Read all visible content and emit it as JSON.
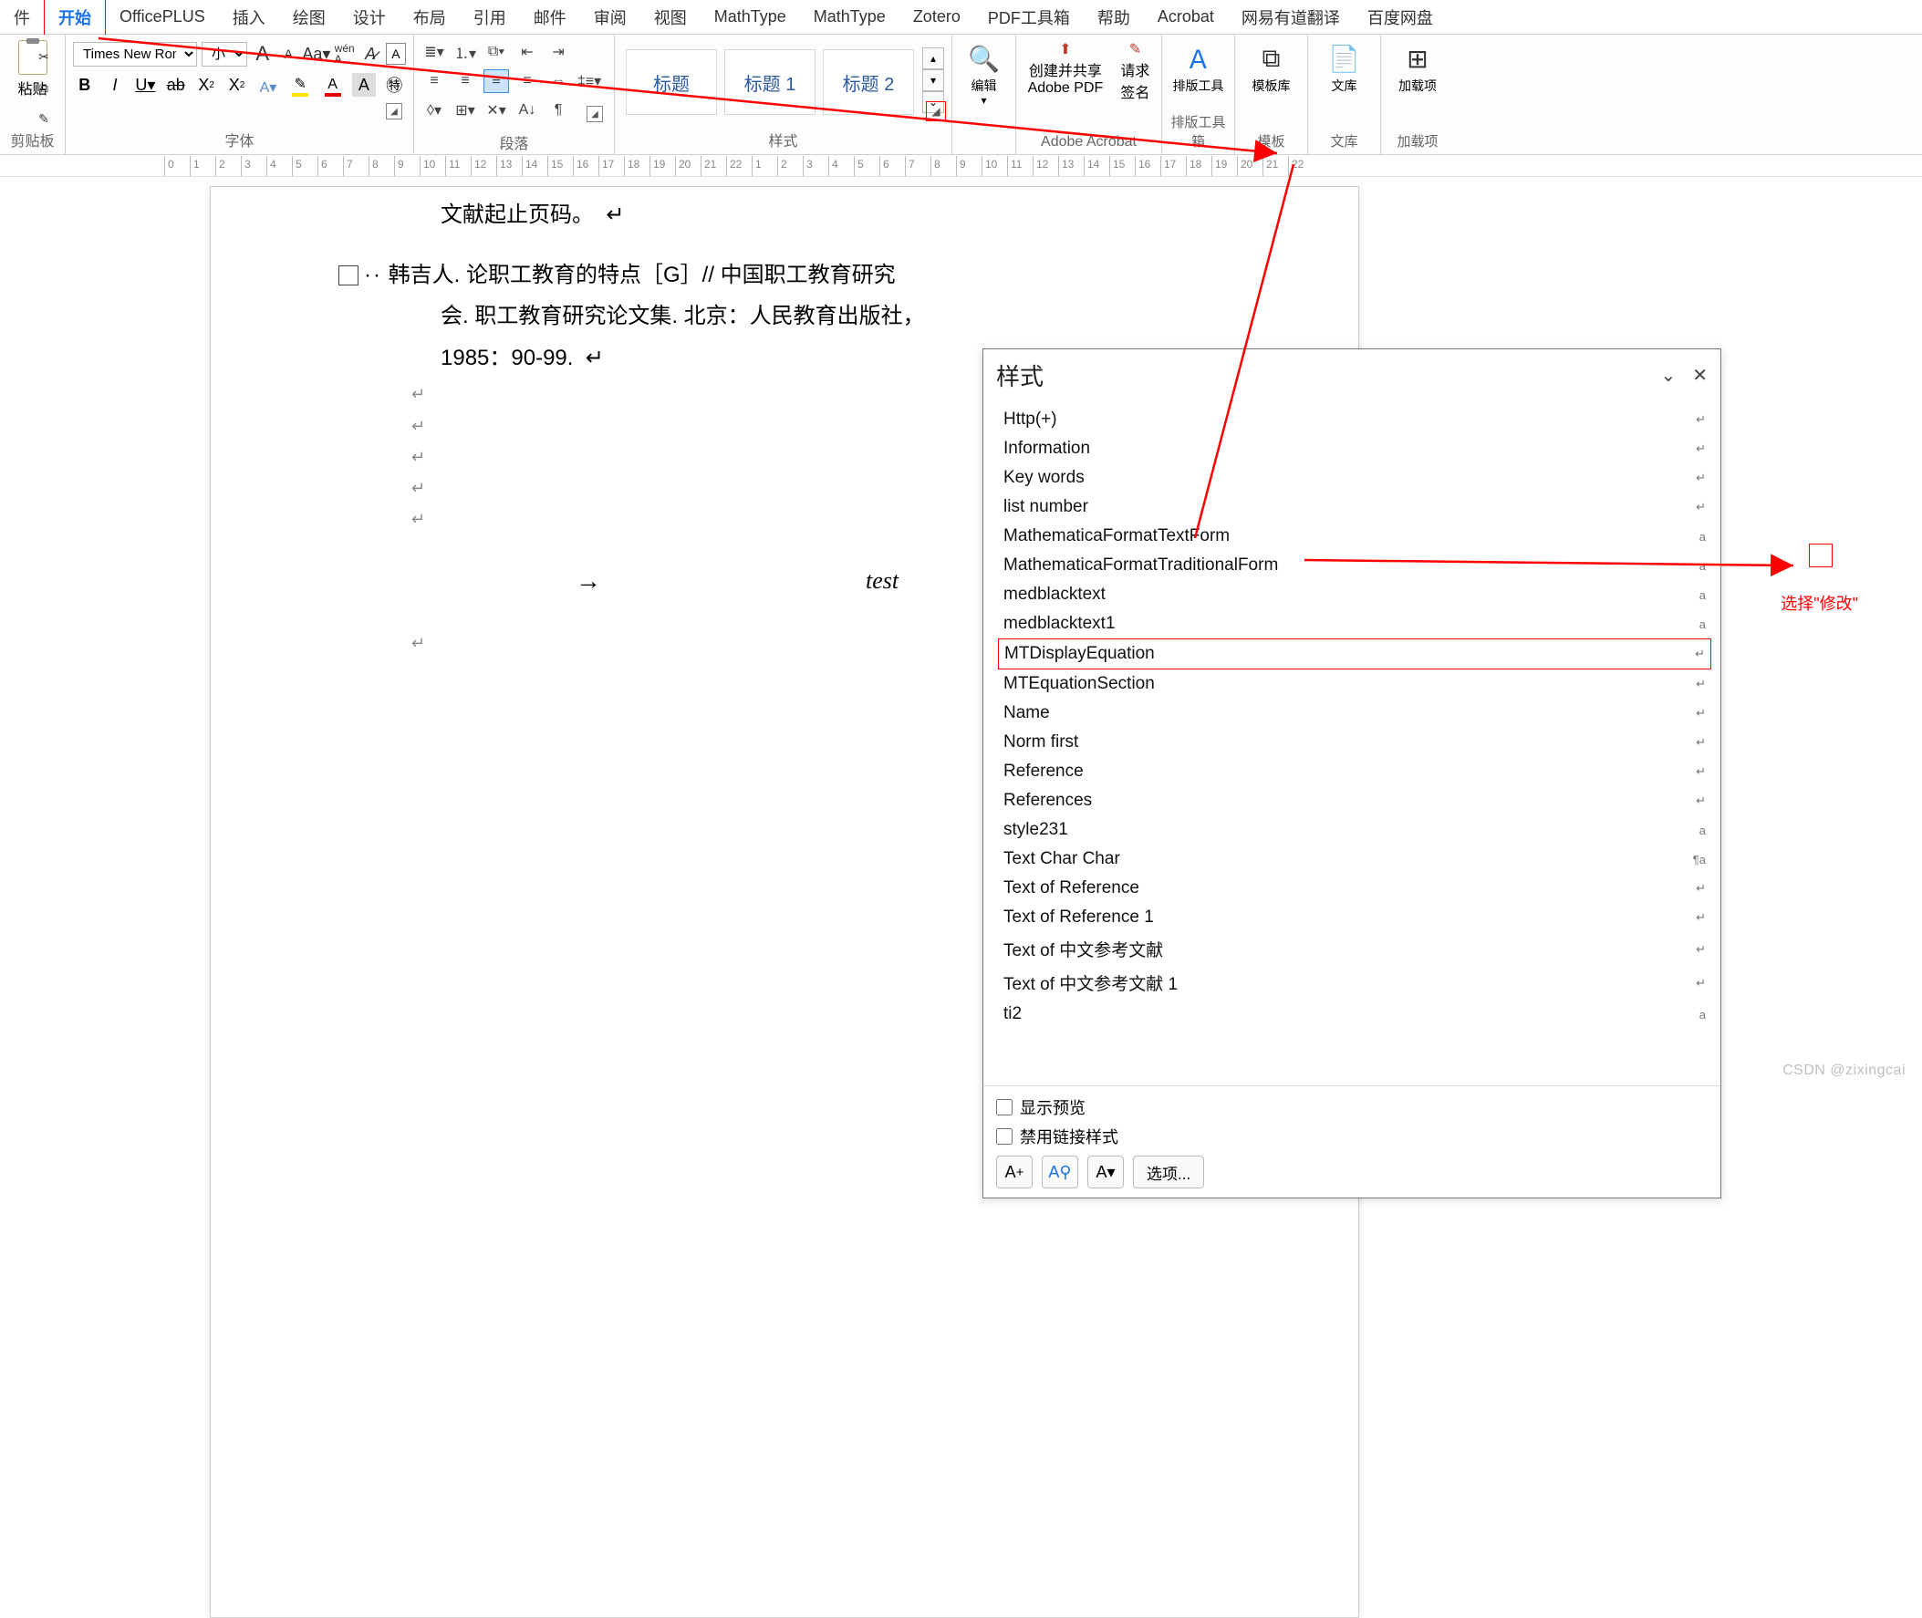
{
  "tabs": {
    "file": "件",
    "home": "开始",
    "officeplus": "OfficePLUS",
    "insert": "插入",
    "draw": "绘图",
    "design": "设计",
    "layout": "布局",
    "references": "引用",
    "mail": "邮件",
    "review": "审阅",
    "view": "视图",
    "mathtype1": "MathType",
    "mathtype2": "MathType",
    "zotero": "Zotero",
    "pdftool": "PDF工具箱",
    "help": "帮助",
    "acrobat": "Acrobat",
    "youdao": "网易有道翻译",
    "baidu": "百度网盘"
  },
  "ribbon": {
    "clipboard": {
      "paste": "粘贴",
      "label": "剪贴板"
    },
    "font": {
      "name": "Times New Roman",
      "size": "小四",
      "label": "字体"
    },
    "paragraph": {
      "label": "段落"
    },
    "styles": {
      "items": [
        "标题",
        "标题 1",
        "标题 2"
      ],
      "label": "样式"
    },
    "edit": {
      "label": "编辑"
    },
    "acrobat": {
      "create": "创建并共享",
      "pdf": "Adobe PDF",
      "request": "请求",
      "sign": "签名",
      "label": "Adobe Acrobat"
    },
    "paiban": {
      "tool": "排版工具",
      "label": "排版工具箱"
    },
    "template": {
      "lib": "模板库",
      "label": "模板"
    },
    "wenku": {
      "lib": "文库",
      "label": "文库"
    },
    "addin": {
      "load": "加载项",
      "label": "加载项"
    }
  },
  "doc": {
    "line1": "文献起止页码。",
    "para2a": "韩吉人. 论职工教育的特点［G］// 中国职工教育研究",
    "para2b": "会. 职工教育研究论文集. 北京：人民教育出版社，",
    "para2c": "1985：90-99.",
    "test": "test"
  },
  "pane": {
    "title": "样式",
    "items": [
      {
        "name": "Http(+)",
        "ind": "↵"
      },
      {
        "name": "Information",
        "ind": "↵"
      },
      {
        "name": "Key words",
        "ind": "↵"
      },
      {
        "name": "list number",
        "ind": "↵"
      },
      {
        "name": "MathematicaFormatTextForm",
        "ind": "a"
      },
      {
        "name": "MathematicaFormatTraditionalForm",
        "ind": "a"
      },
      {
        "name": "medblacktext",
        "ind": "a"
      },
      {
        "name": "medblacktext1",
        "ind": "a"
      },
      {
        "name": "MTDisplayEquation",
        "ind": "↵"
      },
      {
        "name": "MTEquationSection",
        "ind": "↵"
      },
      {
        "name": "Name",
        "ind": "↵"
      },
      {
        "name": "Norm first",
        "ind": "↵"
      },
      {
        "name": "Reference",
        "ind": "↵"
      },
      {
        "name": "References",
        "ind": "↵"
      },
      {
        "name": "style231",
        "ind": "a"
      },
      {
        "name": "Text Char Char",
        "ind": "¶a"
      },
      {
        "name": "Text of Reference",
        "ind": "↵"
      },
      {
        "name": "Text of Reference 1",
        "ind": "↵"
      },
      {
        "name": "Text of 中文参考文献",
        "ind": "↵"
      },
      {
        "name": "Text of 中文参考文献 1",
        "ind": "↵"
      },
      {
        "name": "ti2",
        "ind": "a"
      }
    ],
    "show_preview": "显示预览",
    "disable_linked": "禁用链接样式",
    "options": "选项...",
    "anno": "选择\"修改\""
  },
  "watermark": "CSDN @zixingcai"
}
